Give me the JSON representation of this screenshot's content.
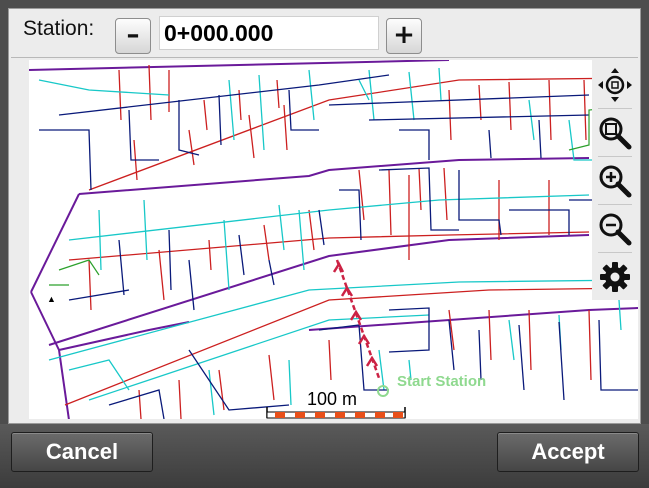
{
  "station": {
    "label": "Station:",
    "decrement_symbol": "–",
    "increment_symbol": "+",
    "value": "0+000.000"
  },
  "map": {
    "scale_label": "100 m",
    "start_label": "Start Station",
    "tools": [
      "zoom-extents-icon",
      "zoom-window-icon",
      "zoom-in-icon",
      "zoom-out-icon",
      "settings-gear-icon"
    ]
  },
  "footer": {
    "cancel_label": "Cancel",
    "accept_label": "Accept"
  },
  "colors": {
    "alignment": "#cc2244",
    "road_edge": "#6a1a9a",
    "water_lines": "#18c8c8",
    "sewer_lines": "#0a1a7a",
    "gas_lines": "#cc2020",
    "start_label": "#8fd98f"
  }
}
